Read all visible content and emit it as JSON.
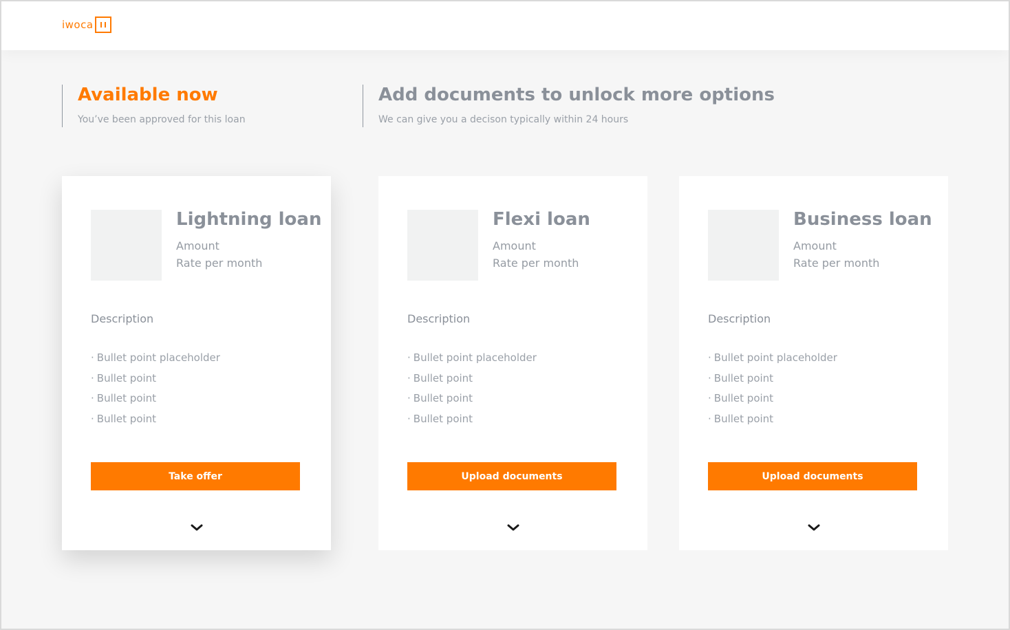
{
  "brand": {
    "logo_text": "iwoca",
    "accent": "#ff7a00"
  },
  "available": {
    "title": "Available now",
    "subtitle": "You’ve been approved for this loan"
  },
  "unlock": {
    "title": "Add documents to unlock more options",
    "subtitle": "We can give you a decison typically within 24 hours"
  },
  "cards": [
    {
      "title": "Lightning loan",
      "amount_label": "Amount",
      "rate_label": "Rate per month",
      "description_label": "Description",
      "bullets": [
        "Bullet point placeholder",
        "Bullet point",
        "Bullet point",
        "Bullet point"
      ],
      "button_label": "Take offer",
      "expand_icon": "chevron-down-icon"
    },
    {
      "title": "Flexi loan",
      "amount_label": "Amount",
      "rate_label": "Rate per month",
      "description_label": "Description",
      "bullets": [
        "Bullet point placeholder",
        "Bullet point",
        "Bullet point",
        "Bullet point"
      ],
      "button_label": "Upload documents",
      "expand_icon": "chevron-down-icon"
    },
    {
      "title": "Business loan",
      "amount_label": "Amount",
      "rate_label": "Rate per month",
      "description_label": "Description",
      "bullets": [
        "Bullet point placeholder",
        "Bullet point",
        "Bullet point",
        "Bullet point"
      ],
      "button_label": "Upload documents",
      "expand_icon": "chevron-down-icon"
    }
  ]
}
